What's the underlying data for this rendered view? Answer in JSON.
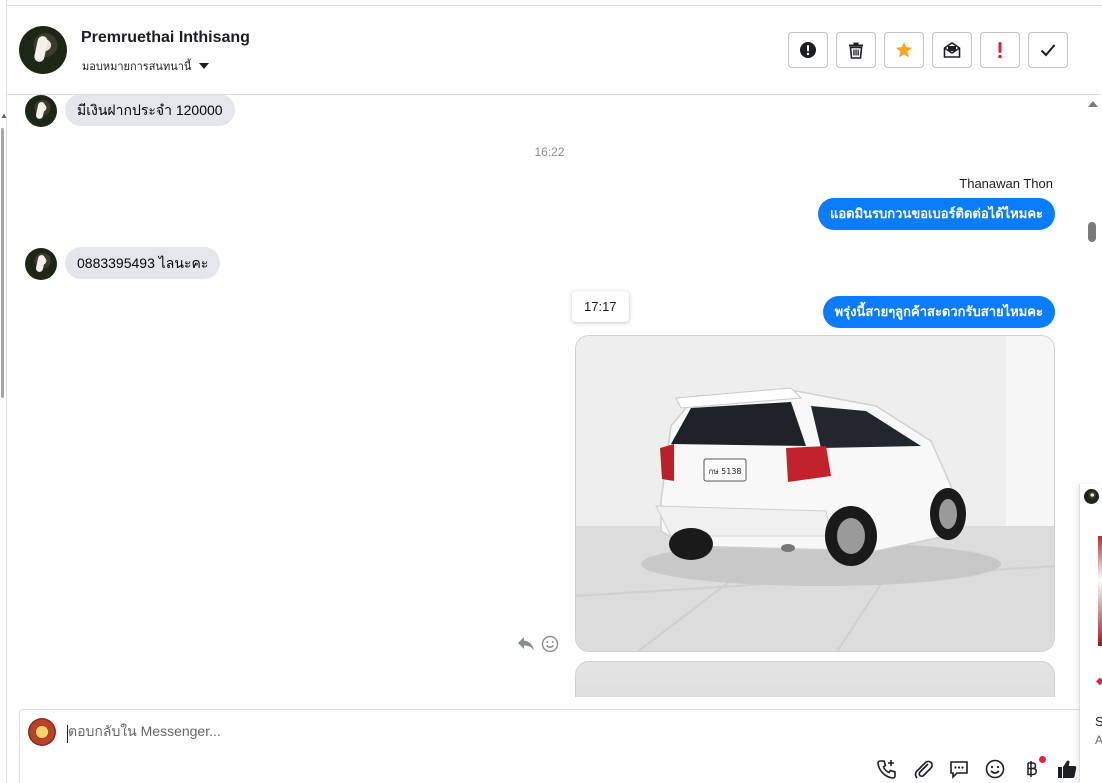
{
  "header": {
    "contact_name": "Premruethai Inthisang",
    "assign_label": "มอบหมายการสนทนานี้"
  },
  "thread": {
    "messages": [
      {
        "direction": "in",
        "text": "มีเงินฝากประจำ 120000"
      },
      {
        "type": "timestamp",
        "text": "16:22"
      },
      {
        "direction": "out",
        "sender": "Thanawan Thon",
        "text": "แอดมินรบกวนขอเบอร์ติดต่อได้ไหมคะ"
      },
      {
        "direction": "in",
        "text": "0883395493  ไลนะคะ"
      },
      {
        "direction": "out",
        "text": "พรุ่งนี้สายๆลูกค้าสะดวกรับสายไหมคะ",
        "time_tooltip": "17:17"
      }
    ],
    "photo": {
      "plate": "กษ 5138"
    }
  },
  "composer": {
    "placeholder": "ตอบกลับใน Messenger..."
  },
  "side_panel": {
    "line1": "S",
    "line2": "A"
  },
  "colors": {
    "outgoing_bubble": "#0a7cff",
    "incoming_bubble": "#e4e6eb",
    "star": "#f5a623",
    "alert": "#e41e3f"
  }
}
